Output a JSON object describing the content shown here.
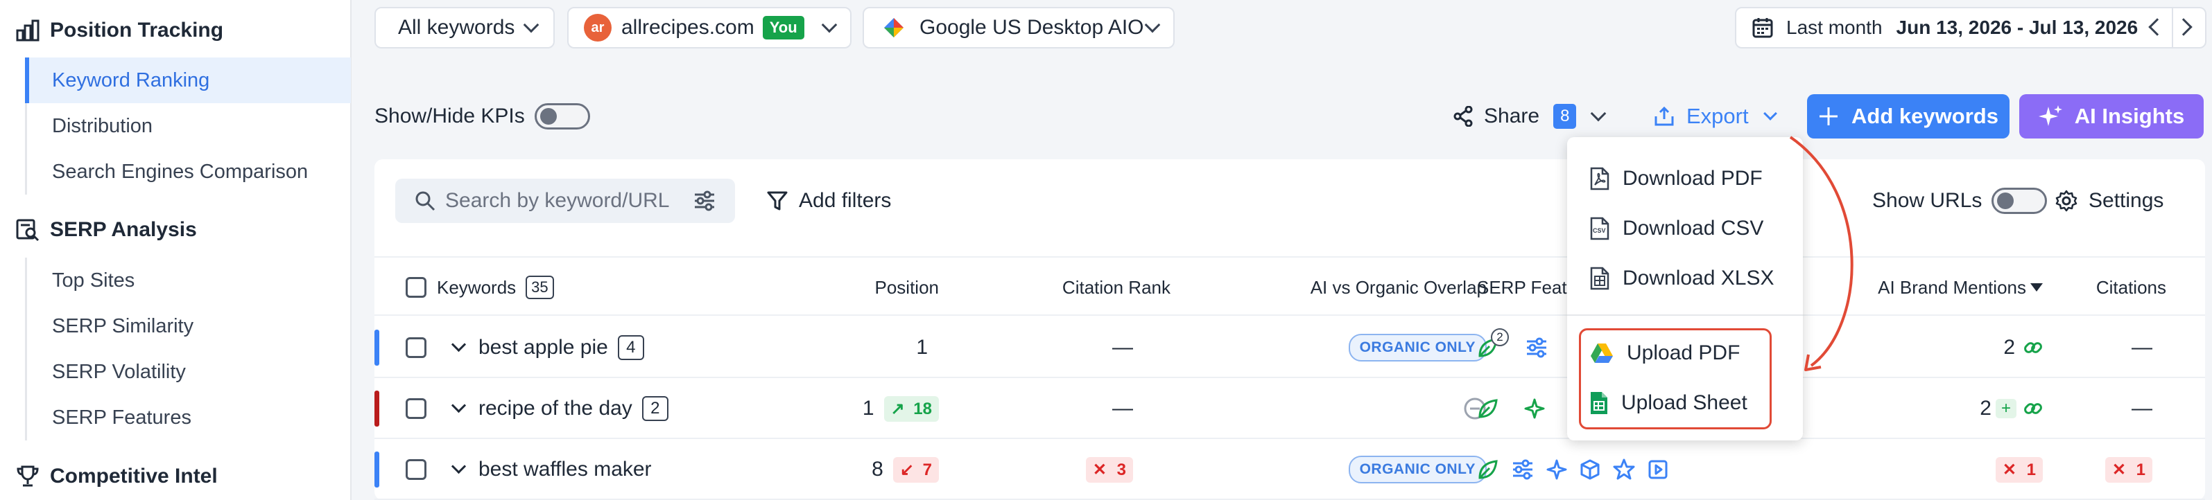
{
  "sidebar": {
    "sections": [
      {
        "label": "Position Tracking",
        "items": [
          "Keyword Ranking",
          "Distribution",
          "Search Engines Comparison"
        ]
      },
      {
        "label": "SERP Analysis",
        "items": [
          "Top Sites",
          "SERP Similarity",
          "SERP Volatility",
          "SERP Features"
        ]
      },
      {
        "label": "Competitive Intel",
        "items": []
      }
    ],
    "active_item": "Keyword Ranking"
  },
  "topbar": {
    "keywords_filter": "All keywords",
    "domain": "allrecipes.com",
    "domain_badge": "You",
    "engine": "Google US Desktop AIO",
    "date_label": "Last month",
    "date_range": "Jun 13, 2026 - Jul 13, 2026"
  },
  "toolbar": {
    "kpi_toggle_label": "Show/Hide KPIs",
    "share_label": "Share",
    "share_count": "8",
    "export_label": "Export",
    "add_keywords_label": "Add keywords",
    "ai_insights_label": "AI Insights"
  },
  "filters": {
    "search_placeholder": "Search by keyword/URL",
    "add_filters_label": "Add filters",
    "show_urls_label": "Show URLs",
    "settings_label": "Settings"
  },
  "table": {
    "columns": {
      "keywords": "Keywords",
      "keywords_count": "35",
      "position": "Position",
      "citation_rank": "Citation Rank",
      "overlap": "AI vs Organic Overlap",
      "serp_features": "SERP Featu",
      "brand_mentions": "AI Brand Mentions",
      "citations": "Citations"
    },
    "rows": [
      {
        "keyword": "best apple pie",
        "count": "4",
        "position": "1",
        "change": "",
        "citation_rank": "—",
        "overlap": "ORGANIC ONLY",
        "serp_badge": "2",
        "brand_mentions": "2",
        "citations": "—",
        "bar_color": "#3b82f6"
      },
      {
        "keyword": "recipe of the day",
        "count": "2",
        "position": "1",
        "change": "18",
        "citation_rank": "—",
        "overlap": "",
        "serp_badge": "",
        "brand_mentions": "2",
        "brand_plus": "+",
        "citations": "—",
        "bar_color": "#b91c1c"
      },
      {
        "keyword": "best waffles maker",
        "count": "",
        "position": "8",
        "change": "7",
        "citation_rank": "3",
        "overlap": "ORGANIC ONLY",
        "serp_badge": "",
        "brand_mentions": "1",
        "citations": "1",
        "bar_color": "#3b82f6"
      }
    ]
  },
  "export_menu": {
    "download_pdf": "Download PDF",
    "download_csv": "Download CSV",
    "download_xlsx": "Download XLSX",
    "upload_pdf": "Upload PDF",
    "upload_sheet": "Upload Sheet",
    "csv_icon_text": "CSV"
  },
  "colors": {
    "accent": "#3b82f6",
    "ai_purple": "#8b6cf6",
    "positive": "#16a34a",
    "negative": "#dc2626",
    "highlight": "#e14a36"
  }
}
